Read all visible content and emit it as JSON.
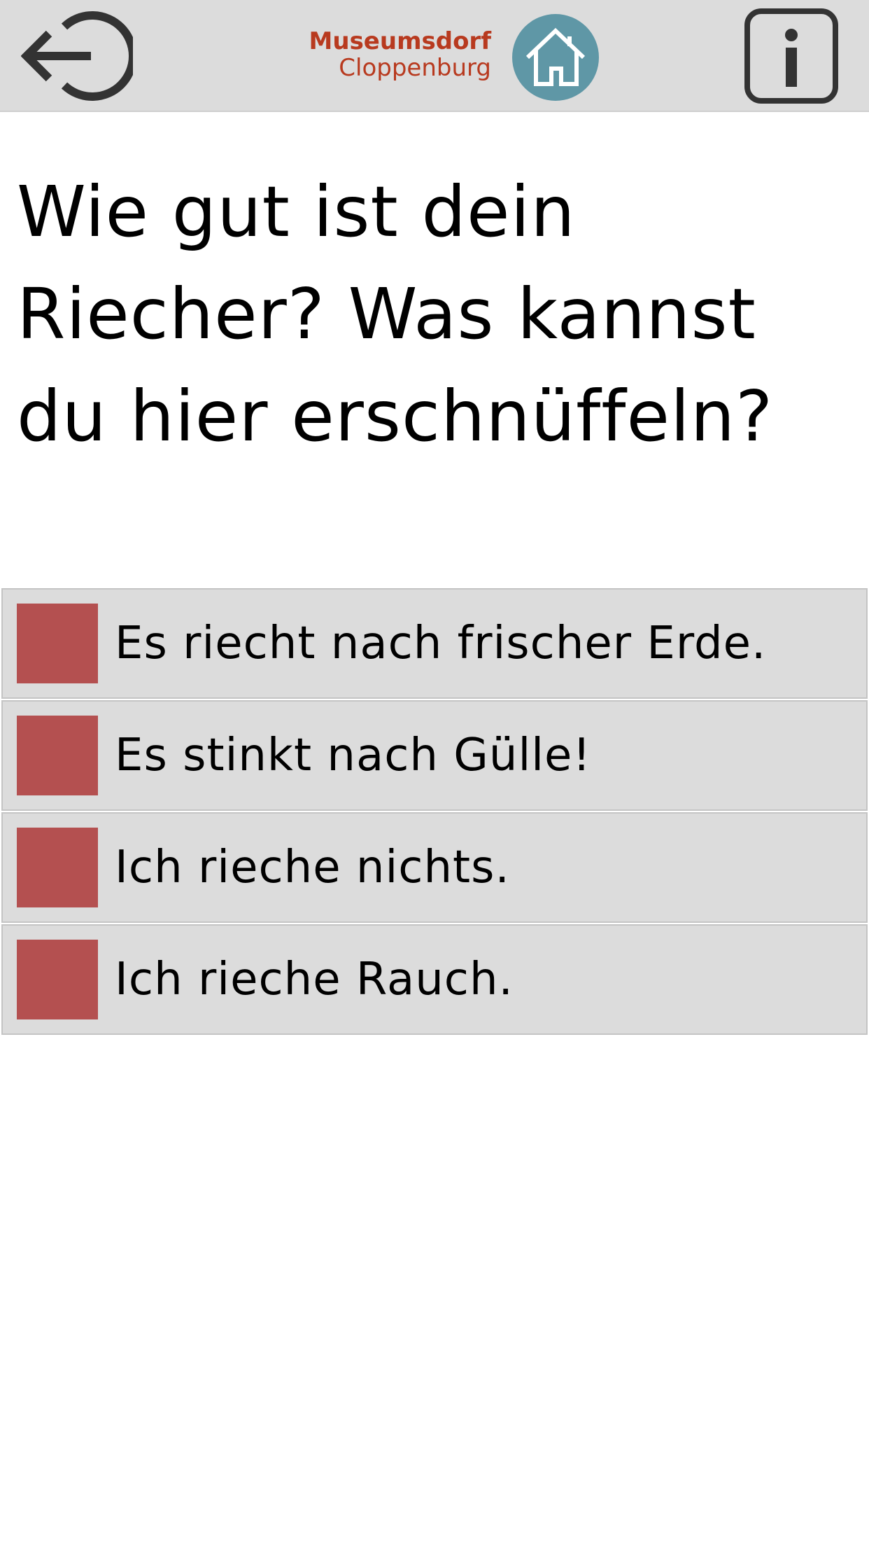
{
  "header": {
    "back_icon": "logout-arrow-icon",
    "logo": {
      "line1": "Museumsdorf",
      "line2": "Cloppenburg",
      "icon": "house-icon",
      "text_color": "#b83a1f",
      "circle_color": "#5f97a6"
    },
    "info_icon": "info-icon",
    "background": "#dcdcdc"
  },
  "question": {
    "text": "Wie gut ist dein Riecher? Was kannst du hier erschnüffeln?"
  },
  "answers": [
    {
      "label": "Es riecht nach frischer Erde.",
      "checked": false
    },
    {
      "label": "Es stinkt nach Gülle!",
      "checked": false
    },
    {
      "label": "Ich rieche nichts.",
      "checked": false
    },
    {
      "label": "Ich rieche Rauch.",
      "checked": false
    }
  ],
  "colors": {
    "checkbox": "#b45050",
    "answer_background": "#dcdcdc"
  }
}
